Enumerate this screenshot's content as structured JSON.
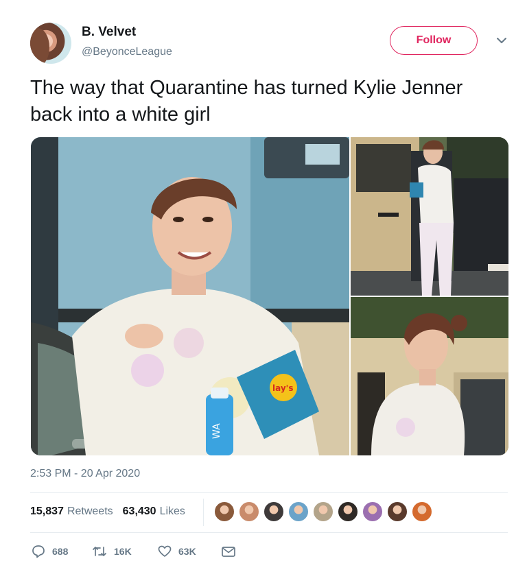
{
  "tweet": {
    "author_name": "B. Velvet",
    "author_handle": "@BeyonceLeague",
    "follow_label": "Follow",
    "text": "The way that Quarantine has turned Kylie Jenner back into a white girl",
    "timestamp": "2:53 PM - 20 Apr 2020"
  },
  "stats": {
    "retweets_count": "15,837",
    "retweets_label": "Retweets",
    "likes_count": "63,430",
    "likes_label": "Likes"
  },
  "actions": {
    "reply_count": "688",
    "retweet_count": "16K",
    "like_count": "63K"
  },
  "media": {
    "photo_count": 3,
    "bag_text": "lay's",
    "bottle_text": "WA"
  },
  "likers": [
    {
      "name": "liker-1",
      "color": "#8a5a3b"
    },
    {
      "name": "liker-2",
      "color": "#c98b6b"
    },
    {
      "name": "liker-3",
      "color": "#3e3a3a"
    },
    {
      "name": "liker-4",
      "color": "#6ba3c9"
    },
    {
      "name": "liker-5",
      "color": "#b3a48a"
    },
    {
      "name": "liker-6",
      "color": "#2f2a26"
    },
    {
      "name": "liker-7",
      "color": "#9b6fb0"
    },
    {
      "name": "liker-8",
      "color": "#5a3a2c"
    },
    {
      "name": "liker-9",
      "color": "#d46a2e"
    }
  ],
  "colors": {
    "accent": "#e0245e",
    "secondary_text": "#657786",
    "primary_text": "#14171a"
  },
  "icons": [
    "chevron-down-icon",
    "reply-icon",
    "retweet-icon",
    "heart-icon",
    "message-icon"
  ]
}
